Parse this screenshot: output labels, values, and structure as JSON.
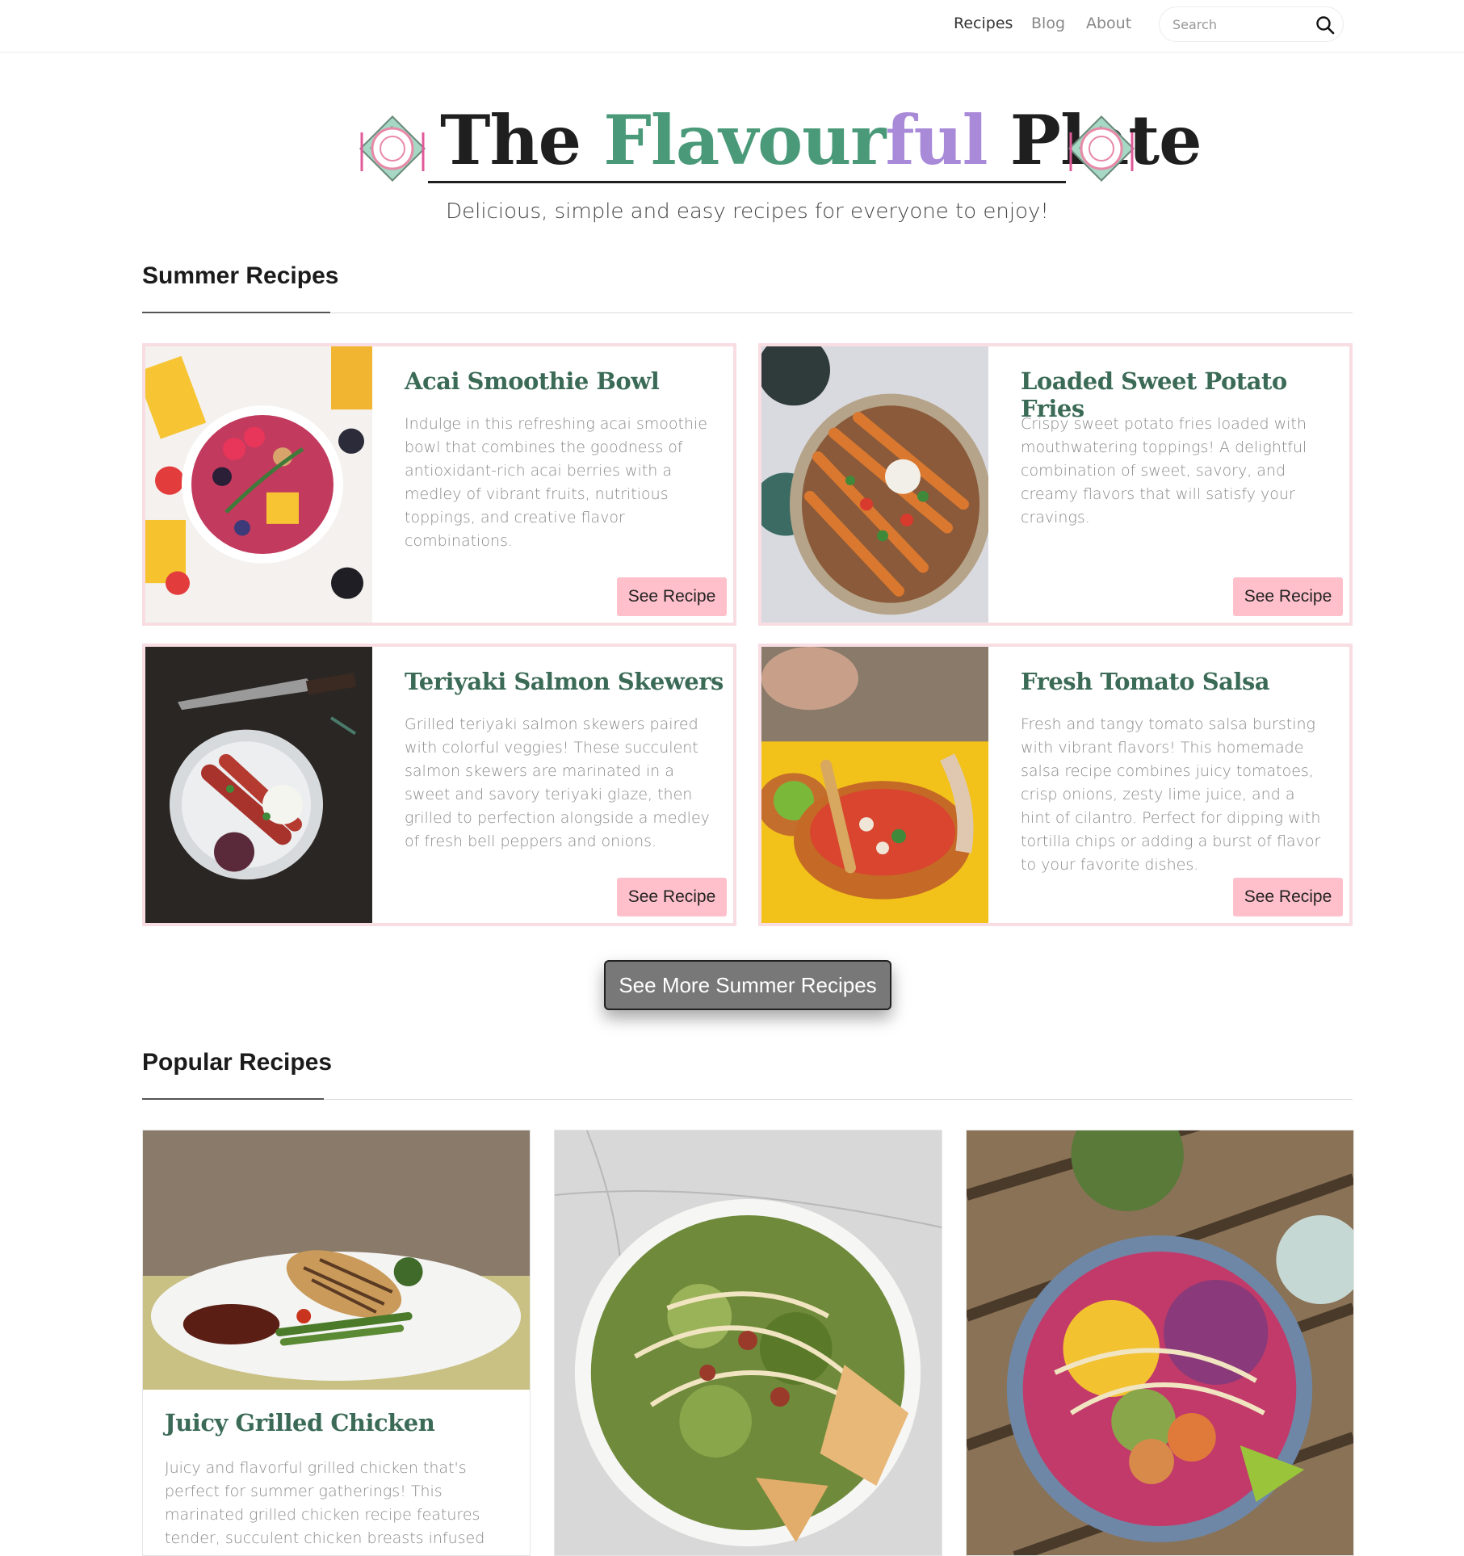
{
  "nav": {
    "links": [
      "Recipes",
      "Blog",
      "About"
    ],
    "search_placeholder": "Search"
  },
  "header": {
    "title_part1": "The",
    "title_part2": "Flavour",
    "title_part3": "ful",
    "title_part4": "Plate",
    "tagline": "Delicious, simple and easy recipes for everyone to enjoy!"
  },
  "summer": {
    "heading": "Summer Recipes",
    "button_label": "See Recipe",
    "more_label": "See More Summer Recipes",
    "cards": [
      {
        "title": "Acai Smoothie Bowl",
        "desc": "Indulge in this refreshing acai smoothie bowl that combines the goodness of antioxidant-rich acai berries with a medley of vibrant fruits, nutritious toppings, and creative flavor combinations."
      },
      {
        "title": "Loaded Sweet Potato Fries",
        "desc": "Crispy sweet potato fries loaded with mouthwatering toppings! A delightful combination of sweet, savory, and creamy flavors that will satisfy your cravings."
      },
      {
        "title": "Teriyaki Salmon Skewers",
        "desc": "Grilled teriyaki salmon skewers paired with colorful veggies! These succulent salmon skewers are marinated in a sweet and savory teriyaki glaze, then grilled to perfection alongside a medley of fresh bell peppers and onions."
      },
      {
        "title": "Fresh Tomato Salsa",
        "desc": "Fresh and tangy tomato salsa bursting with vibrant flavors! This homemade salsa recipe combines juicy tomatoes, crisp onions, zesty lime juice, and a hint of cilantro. Perfect for dipping with tortilla chips or adding a burst of flavor to your favorite dishes."
      }
    ]
  },
  "popular": {
    "heading": "Popular Recipes",
    "cards": [
      {
        "title": "Juicy Grilled Chicken",
        "desc": "Juicy and flavorful grilled chicken that's perfect for summer gatherings! This marinated grilled chicken recipe features tender, succulent chicken breasts infused with a blend of"
      }
    ]
  },
  "colors": {
    "accent_pink": "#ffc0cb",
    "card_border": "#f8dde3",
    "title_green": "#3b6b57",
    "logo_green": "#4a9a7a",
    "logo_purple": "#a88ad8"
  }
}
